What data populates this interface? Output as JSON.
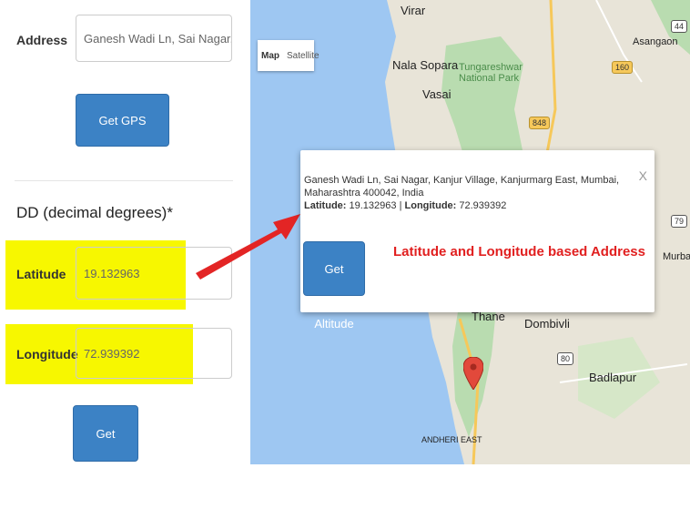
{
  "form": {
    "address_label": "Address",
    "address_value": "Ganesh Wadi Ln, Sai Nagar, Kanjur Villa",
    "gps_button": "Get GPS Coordinates",
    "section_title": "DD (decimal degrees)*",
    "latitude_label": "Latitude",
    "latitude_value": "19.132963",
    "longitude_label": "Longitude",
    "longitude_value": "72.939392",
    "get_address_button": "Get Address"
  },
  "map": {
    "map_type": [
      "Map",
      "Satellite"
    ],
    "labels": {
      "virar": "Virar",
      "nala_sopara": "Nala Sopara",
      "vasai": "Vasai",
      "tungareshwar": "Tungareshwar National Park",
      "asangaon": "Asangaon",
      "thane": "Thane",
      "dombivli": "Dombivli",
      "badlapur": "Badlapur",
      "murbad": "Murbad",
      "andheri_east": "ANDHERI EAST"
    },
    "shields": [
      "44",
      "160",
      "848",
      "79",
      "80"
    ],
    "colors": {
      "water": "#9ec7f2",
      "land": "#e8e4d8",
      "park": "#b9dcb0",
      "marker": "#e2493b"
    }
  },
  "popup": {
    "address": "Ganesh Wadi Ln, Sai Nagar, Kanjur Village, Kanjurmarg East, Mumbai, Maharashtra 400042, India",
    "latitude_label": "Latitude:",
    "latitude_value": "19.132963",
    "separator": "|",
    "longitude_label": "Longitude:",
    "longitude_value": "72.939392",
    "close": "X",
    "altitude_button": "Get Altitude"
  },
  "annotation": {
    "text": "Latitude and Longitude based Address",
    "color": "#e12020"
  }
}
